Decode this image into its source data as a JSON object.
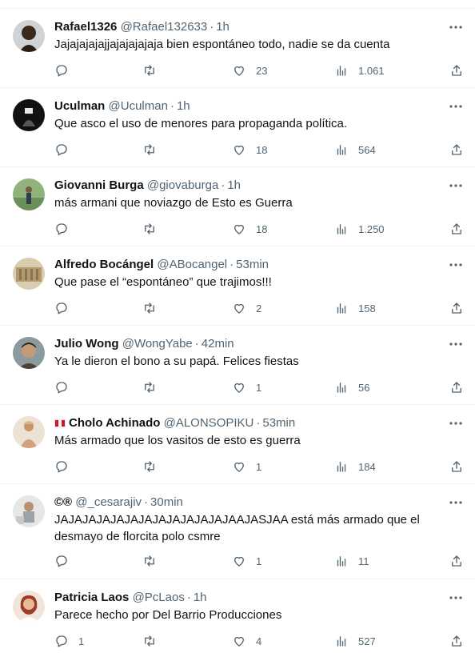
{
  "tweets": [
    {
      "name": "Rafael1326",
      "handle": "@Rafael132633",
      "time": "1h",
      "text": "Jajajajajajjajajajajaja bien espontáneo todo, nadie se da cuenta",
      "replies": "",
      "likes": "23",
      "views": "1.061",
      "avatar_color": "#3a2a1c"
    },
    {
      "name": "Uculman",
      "handle": "@Uculman",
      "time": "1h",
      "text": "Que asco el uso de menores para propaganda política.",
      "replies": "",
      "likes": "18",
      "views": "564",
      "avatar_color": "#111111"
    },
    {
      "name": "Giovanni Burga",
      "handle": "@giovaburga",
      "time": "1h",
      "text": "más armani que noviazgo de Esto es Guerra",
      "replies": "",
      "likes": "18",
      "views": "1.250",
      "avatar_color": "#6b8f58"
    },
    {
      "name": "Alfredo Bocángel",
      "handle": "@ABocangel",
      "time": "53min",
      "text": "Que pase el “espontáneo” que trajimos!!!",
      "replies": "",
      "likes": "2",
      "views": "158",
      "avatar_color": "#c9b48a"
    },
    {
      "name": "Julio Wong",
      "handle": "@WongYabe",
      "time": "42min",
      "text": "Ya le dieron el bono a su papá. Felices fiestas",
      "replies": "",
      "likes": "1",
      "views": "56",
      "avatar_color": "#7d6a55"
    },
    {
      "name": "Cholo Achinado",
      "handle": "@ALONSOPIKU",
      "time": "53min",
      "text": "Más armado que los vasitos de esto es guerra",
      "replies": "",
      "likes": "1",
      "views": "184",
      "avatar_color": "#d9b896"
    },
    {
      "name": "©®",
      "handle": "@_cesarajiv",
      "time": "30min",
      "text": "JAJAJAJAJAJAJAJAJAJAJAJAJAAJASJAA está más armado que el desmayo de florcita polo csmre",
      "replies": "",
      "likes": "1",
      "views": "11",
      "avatar_color": "#c7c7c7"
    },
    {
      "name": "Patricia Laos",
      "handle": "@PcLaos",
      "time": "1h",
      "text": "Parece hecho por Del Barrio Producciones",
      "replies": "1",
      "likes": "4",
      "views": "527",
      "avatar_color": "#c25a3c"
    }
  ],
  "colors": {
    "text": "#0f1419",
    "secondary": "#536471",
    "divider": "#eff3f4"
  }
}
